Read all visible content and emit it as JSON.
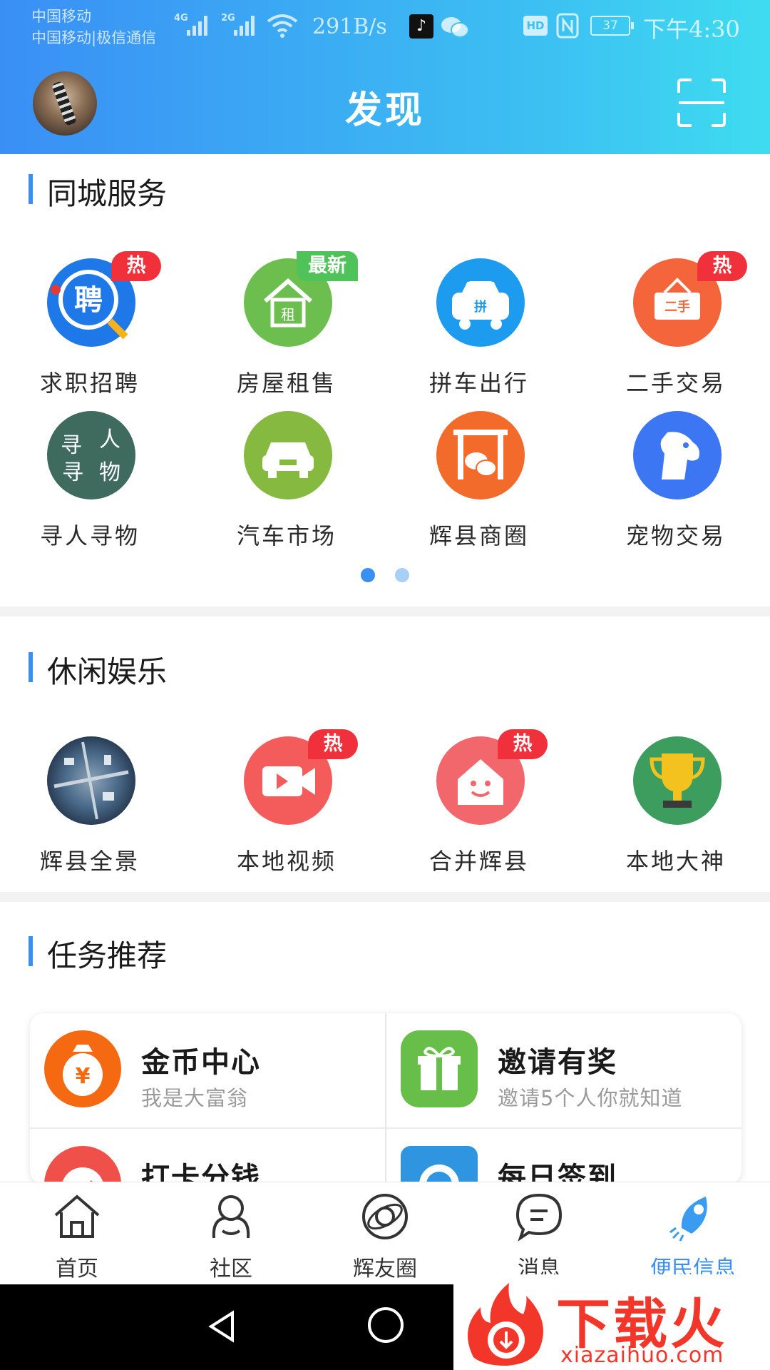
{
  "status_bar": {
    "carrier_1": "中国移动",
    "carrier_2": "中国移动|极信通信",
    "sig1": "4G",
    "sig2": "2G",
    "net_speed": "291B/s",
    "hd": "HD",
    "battery": "37",
    "time": "下午4:30"
  },
  "header": {
    "title": "发现"
  },
  "sections": {
    "city": {
      "title": "同城服务",
      "items": [
        {
          "label": "求职招聘",
          "badge": "热",
          "icon": "recruit-icon",
          "color": "#1e78e8"
        },
        {
          "label": "房屋租售",
          "badge": "最新",
          "icon": "house-rent-icon",
          "color": "#6cbf4f"
        },
        {
          "label": "拼车出行",
          "badge": "",
          "icon": "carpool-icon",
          "color": "#1c9bef"
        },
        {
          "label": "二手交易",
          "badge": "热",
          "icon": "secondhand-icon",
          "color": "#f5653b"
        },
        {
          "label": "寻人寻物",
          "badge": "",
          "icon": "lost-found-icon",
          "color": "#3f6b5f"
        },
        {
          "label": "汽车市场",
          "badge": "",
          "icon": "car-market-icon",
          "color": "#86b93f"
        },
        {
          "label": "辉县商圈",
          "badge": "",
          "icon": "business-circle-icon",
          "color": "#f26b2a"
        },
        {
          "label": "宠物交易",
          "badge": "",
          "icon": "pet-icon",
          "color": "#3c76f2"
        }
      ]
    },
    "leisure": {
      "title": "休闲娱乐",
      "items": [
        {
          "label": "辉县全景",
          "badge": "",
          "icon": "panorama-icon",
          "color": "#3c5a78"
        },
        {
          "label": "本地视频",
          "badge": "热",
          "icon": "video-icon",
          "color": "#f45b5b"
        },
        {
          "label": "合并辉县",
          "badge": "热",
          "icon": "merge-game-icon",
          "color": "#f2676b"
        },
        {
          "label": "本地大神",
          "badge": "",
          "icon": "trophy-icon",
          "color": "#3d9d5f"
        }
      ]
    },
    "tasks": {
      "title": "任务推荐",
      "items": [
        {
          "name": "金币中心",
          "sub": "我是大富翁",
          "icon": "coin-bag-icon",
          "color": "#f56a10"
        },
        {
          "name": "邀请有奖",
          "sub": "邀请5个人你就知道",
          "icon": "gift-icon",
          "color": "#67bf4a"
        },
        {
          "name": "打卡分钱",
          "sub": "",
          "icon": "checkin-clock-icon",
          "color": "#f0504a"
        },
        {
          "name": "每日签到",
          "sub": "",
          "icon": "sign-in-icon",
          "color": "#2f95e0"
        }
      ]
    }
  },
  "tabbar": [
    {
      "label": "首页",
      "icon": "home-icon"
    },
    {
      "label": "社区",
      "icon": "community-icon"
    },
    {
      "label": "辉友圈",
      "icon": "planet-icon"
    },
    {
      "label": "消息",
      "icon": "message-icon"
    },
    {
      "label": "便民信息",
      "icon": "rocket-icon"
    }
  ],
  "watermark": {
    "text": "下载火",
    "url": "xiazaihuo.com"
  },
  "colors": {
    "accent": "#3a8ff5",
    "hot": "#f0303a",
    "new": "#4fc35a"
  }
}
